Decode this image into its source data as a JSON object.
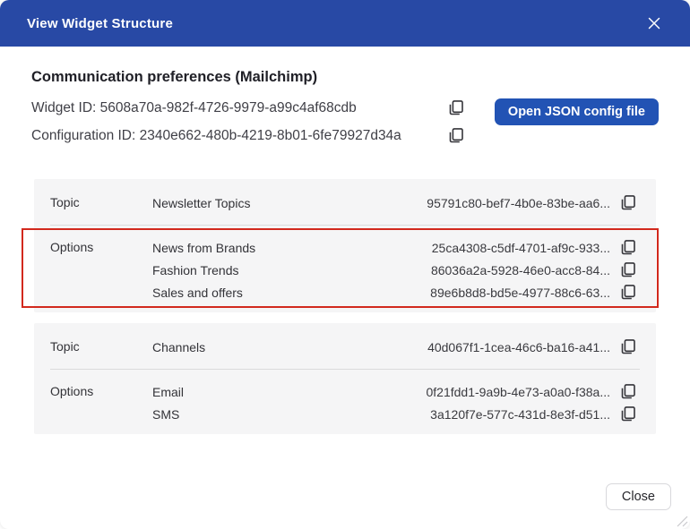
{
  "dialog": {
    "title": "View Widget Structure"
  },
  "widget": {
    "name": "Communication preferences (Mailchimp)",
    "widget_id_label": "Widget ID:",
    "widget_id": "5608a70a-982f-4726-9979-a99c4af68cdb",
    "widget_id_line": "Widget ID: 5608a70a-982f-4726-9979-a99c4af68cdb",
    "config_id_label": "Configuration ID:",
    "config_id": "2340e662-480b-4219-8b01-6fe79927d34a",
    "config_id_line": "Configuration ID: 2340e662-480b-4219-8b01-6fe79927d34a",
    "open_json_button_label": "Open JSON config file"
  },
  "table": {
    "groups": [
      {
        "rows": [
          {
            "label": "Topic",
            "items": [
              {
                "name": "Newsletter Topics",
                "id": "95791c80-bef7-4b0e-83be-aa6..."
              }
            ]
          },
          {
            "label": "Options",
            "highlighted": true,
            "items": [
              {
                "name": "News from Brands",
                "id": "25ca4308-c5df-4701-af9c-933..."
              },
              {
                "name": "Fashion Trends",
                "id": "86036a2a-5928-46e0-acc8-84..."
              },
              {
                "name": "Sales and offers",
                "id": "89e6b8d8-bd5e-4977-88c6-63..."
              }
            ]
          }
        ]
      },
      {
        "rows": [
          {
            "label": "Topic",
            "items": [
              {
                "name": "Channels",
                "id": "40d067f1-1cea-46c6-ba16-a41..."
              }
            ]
          },
          {
            "label": "Options",
            "items": [
              {
                "name": "Email",
                "id": "0f21fdd1-9a9b-4e73-a0a0-f38a..."
              },
              {
                "name": "SMS",
                "id": "3a120f7e-577c-431d-8e3f-d51..."
              }
            ]
          }
        ]
      }
    ]
  },
  "footer": {
    "close_label": "Close"
  },
  "icons": {
    "close": "x-mark",
    "copy": "copy-duplicate-squares",
    "resize": "diagonal-resize-grip"
  },
  "colors": {
    "header_blue": "#2849a5",
    "button_blue": "#2253b4",
    "highlight_red": "#d2291d",
    "row_background": "#f5f5f6"
  }
}
